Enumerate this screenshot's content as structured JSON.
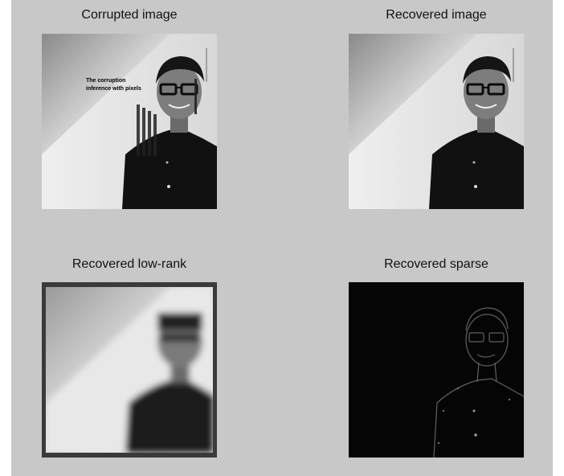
{
  "figure": {
    "background_color": "#c8c8c8",
    "panels": [
      {
        "title": "Corrupted image",
        "image": "photo-of-man-with-glasses-with-overlaid-text"
      },
      {
        "title": "Recovered image",
        "image": "photo-of-man-with-glasses"
      },
      {
        "title": "Recovered low-rank",
        "image": "blurred-low-rank-photo"
      },
      {
        "title": "Recovered sparse",
        "image": "dark-edge-map"
      }
    ],
    "corruption_text": {
      "line1": "The corruption",
      "line2": "inference with pixels"
    }
  }
}
